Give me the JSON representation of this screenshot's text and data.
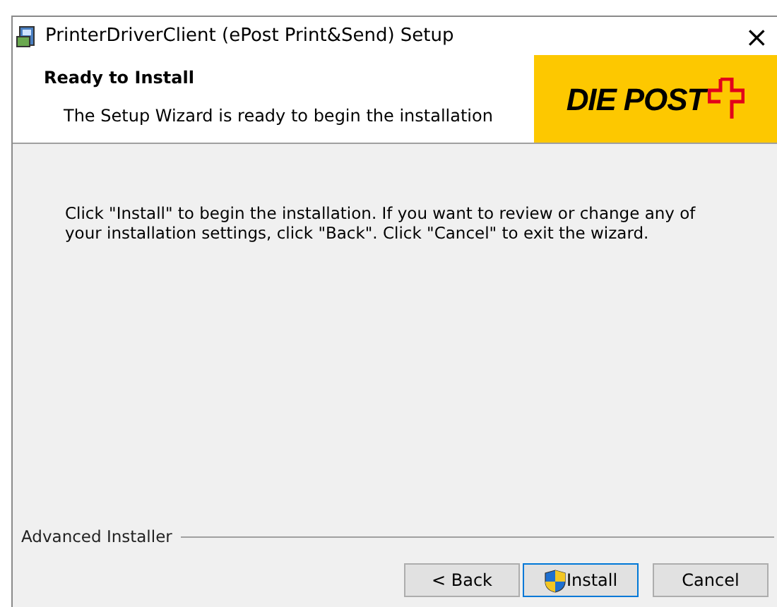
{
  "window": {
    "title": "PrinterDriverClient (ePost Print&Send) Setup",
    "close": "×"
  },
  "header": {
    "title": "Ready to Install",
    "subtitle": "The Setup Wizard is ready to begin the installation",
    "logo": "DIE POST"
  },
  "body": {
    "text": "Click \"Install\" to begin the installation.  If you want to review or change any of your installation settings, click \"Back\".  Click \"Cancel\" to exit the wizard."
  },
  "footer": {
    "brand": "Advanced Installer"
  },
  "buttons": [
    {
      "label": "< Back",
      "kind": "plain",
      "focused": false
    },
    {
      "label": "Install",
      "kind": "shield",
      "focused": true
    },
    {
      "label": "Cancel",
      "kind": "plain",
      "focused": false
    }
  ]
}
